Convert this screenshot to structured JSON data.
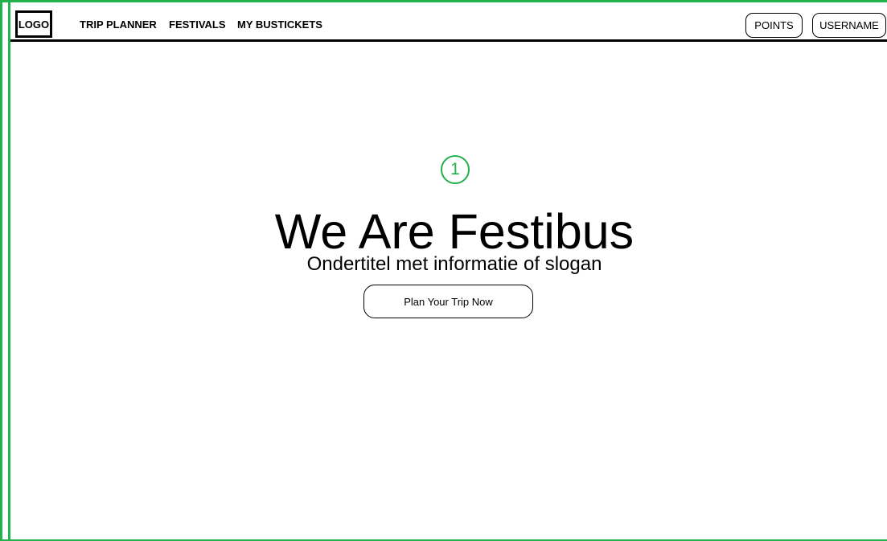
{
  "nav": {
    "logo": "LOGO",
    "links": [
      "TRIP PLANNER",
      "FESTIVALS",
      "MY BUSTICKETS"
    ],
    "points": "POINTS",
    "username": "USERNAME"
  },
  "hero": {
    "badge": "1",
    "title": "We Are Festibus",
    "subtitle": "Ondertitel met informatie of slogan",
    "cta": "Plan Your Trip Now"
  },
  "colors": {
    "accent": "#22b14c",
    "text": "#000000",
    "background": "#ffffff"
  }
}
